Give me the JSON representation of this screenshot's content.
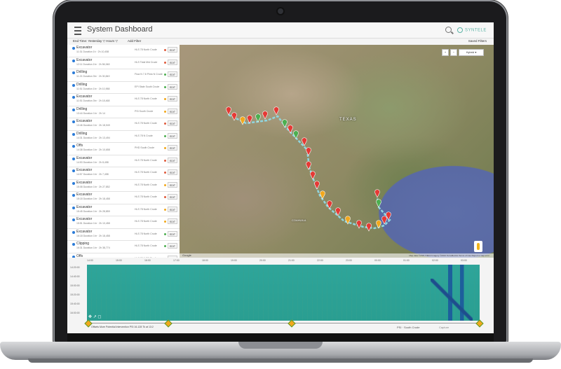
{
  "app": {
    "title": "System Dashboard",
    "brand": "SYNTELE"
  },
  "filterbar": {
    "filters": "End Time: Yesterday ▽  Hours ▽",
    "add_filter": "Add Filter",
    "saved_filters": "Saved Filters"
  },
  "list": {
    "edit_label": "EDIT",
    "items": [
      {
        "type": "Excavator",
        "sub": "11:31 Duration 1h · 2h 10,458",
        "product": "HLS 78 North Crude",
        "status": "#e05b3d"
      },
      {
        "type": "Excavator",
        "sub": "12:11 Duration 1hr · 2h 56,948",
        "product": "HLS Tidal Mid Crude",
        "status": "#e05b3d"
      },
      {
        "type": "Drilling",
        "sub": "11:21 Duration 3hr · 2h 30,849",
        "product": "Flow N 7.8 Pinto N Crude",
        "status": "#4caf50"
      },
      {
        "type": "Drilling",
        "sub": "11:51 Duration 1hr · 2h 10,958",
        "product": "EPI Stale South Crude",
        "status": "#4caf50"
      },
      {
        "type": "Excavator",
        "sub": "11:51 Duration 3hr · 2h 18,468",
        "product": "HLS 78 North Crude",
        "status": "#f2a81d"
      },
      {
        "type": "Drilling",
        "sub": "13:44 Duration 1hr · 2h 14",
        "product": "PSI South Crude",
        "status": "#f2a81d"
      },
      {
        "type": "Excavator",
        "sub": "13:46 Duration 1hr · 2h 18,949",
        "product": "HLS 78 North Crude",
        "status": "#e05b3d"
      },
      {
        "type": "Drilling",
        "sub": "14:31 Duration 1hr · 2h 13,494",
        "product": "HLS 78 N Crude",
        "status": "#4caf50"
      },
      {
        "type": "Offs",
        "sub": "14:38 Duration 1hr · 2h 10,658",
        "product": "PHD South Crude",
        "status": "#f2a81d"
      },
      {
        "type": "Excavator",
        "sub": "14:53 Duration 1hr · 2h 8,458",
        "product": "HLS 78 North Crude",
        "status": "#e05b3d"
      },
      {
        "type": "Excavator",
        "sub": "14:57 Duration 1hr · 2h 7,458",
        "product": "HLS 78 North Crude",
        "status": "#e05b3d"
      },
      {
        "type": "Excavator",
        "sub": "15:08 Duration 1hr · 2h 27,852",
        "product": "HLS 78 North Crude",
        "status": "#f2a81d"
      },
      {
        "type": "Excavator",
        "sub": "15:18 Duration 1hr · 2h 18,458",
        "product": "HLS 78 North Crude",
        "status": "#e05b3d"
      },
      {
        "type": "Excavator",
        "sub": "15:45 Duration 1hr · 2h 28,859",
        "product": "HLS 78 North Crude",
        "status": "#f2a81d"
      },
      {
        "type": "Excavator",
        "sub": "15:51 Duration 1hr · 2h 10,458",
        "product": "HLS 78 North Crude",
        "status": "#f2a81d"
      },
      {
        "type": "Excavator",
        "sub": "16:18 Duration 1hr · 2h 18,458",
        "product": "HLS 78 North Crude",
        "status": "#4caf50"
      },
      {
        "type": "Clipping",
        "sub": "16:31 Duration 1hr · 2h 38,774",
        "product": "HLS 78 North Crude",
        "status": "#4caf50"
      },
      {
        "type": "Offs",
        "sub": "16:38 Duration 1hr · 2h 31,658",
        "product": "HLS 78 N TO Pipeline",
        "status": "#e05b3d"
      },
      {
        "type": "Excavator",
        "sub": "16:51 Duration 1hr · 2h 37,858",
        "product": "HLS 78 North Crude",
        "status": "#e05b3d"
      },
      {
        "type": "Offs",
        "sub": "",
        "product": "",
        "status": "#e05b3d"
      }
    ]
  },
  "map": {
    "zoom_in": "+",
    "zoom_out": "−",
    "layer": "Hybrid ▾",
    "state_label": "TEXAS",
    "region_label": "COAHUILA",
    "google": "Google",
    "footer_text": "Map data ©2021 INEGI Imagery ©2021 TerraMetrics  Terms of Use  Report a map error"
  },
  "timeline": {
    "axis_ticks": [
      "14:00",
      "15:00",
      "16:00",
      "17:00",
      "18:00",
      "19:00",
      "20:00",
      "21:00",
      "22:00",
      "23:00",
      "00:00",
      "01:00",
      "02:00",
      "03:00"
    ],
    "rows": [
      "14:20:00",
      "14:40:00",
      "15:00:00",
      "15:20:00",
      "15:40:00",
      "16:00:00"
    ],
    "status_text": "Offsets More  Potential Intervention  PSI 16-128 Tk at 13:2",
    "bottom_product": "PSI · South Crude",
    "bottom_action": "Capture"
  }
}
